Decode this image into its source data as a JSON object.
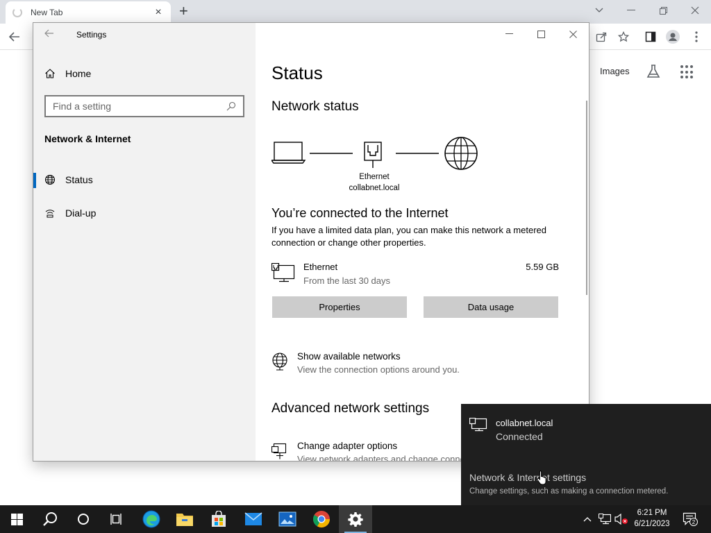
{
  "browser": {
    "tab_title": "New Tab",
    "tab_close": "×",
    "new_tab": "+",
    "images_label": "Images"
  },
  "settings": {
    "app_title": "Settings",
    "home_label": "Home",
    "search_placeholder": "Find a setting",
    "section_heading": "Network & Internet",
    "nav_items": [
      {
        "label": "Status",
        "icon": "globe-icon",
        "active": true
      },
      {
        "label": "Dial-up",
        "icon": "dialup-icon",
        "active": false
      }
    ],
    "page_title": "Status",
    "network_status_heading": "Network status",
    "diagram": {
      "adapter_name": "Ethernet",
      "network_name": "collabnet.local"
    },
    "connected_heading": "You’re connected to the Internet",
    "connected_desc": "If you have a limited data plan, you can make this network a metered connection or change other properties.",
    "usage": {
      "name": "Ethernet",
      "period": "From the last 30 days",
      "amount": "5.59 GB"
    },
    "buttons": {
      "properties": "Properties",
      "data_usage": "Data usage"
    },
    "show_networks": {
      "title": "Show available networks",
      "desc": "View the connection options around you."
    },
    "advanced_heading": "Advanced network settings",
    "change_adapter": {
      "title": "Change adapter options",
      "desc": "View network adapters and change connection settings."
    }
  },
  "flyout": {
    "network_name": "collabnet.local",
    "status": "Connected",
    "settings_link": "Network & Internet settings",
    "settings_desc": "Change settings, such as making a connection metered."
  },
  "taskbar": {
    "time": "6:21 PM",
    "date": "6/21/2023",
    "notification_count": "2"
  },
  "colors": {
    "accent": "#0067c0",
    "sidebar_bg": "#f2f2f2",
    "flyout_bg": "#1f1f1f",
    "taskbar_bg": "#1a1a1a"
  }
}
